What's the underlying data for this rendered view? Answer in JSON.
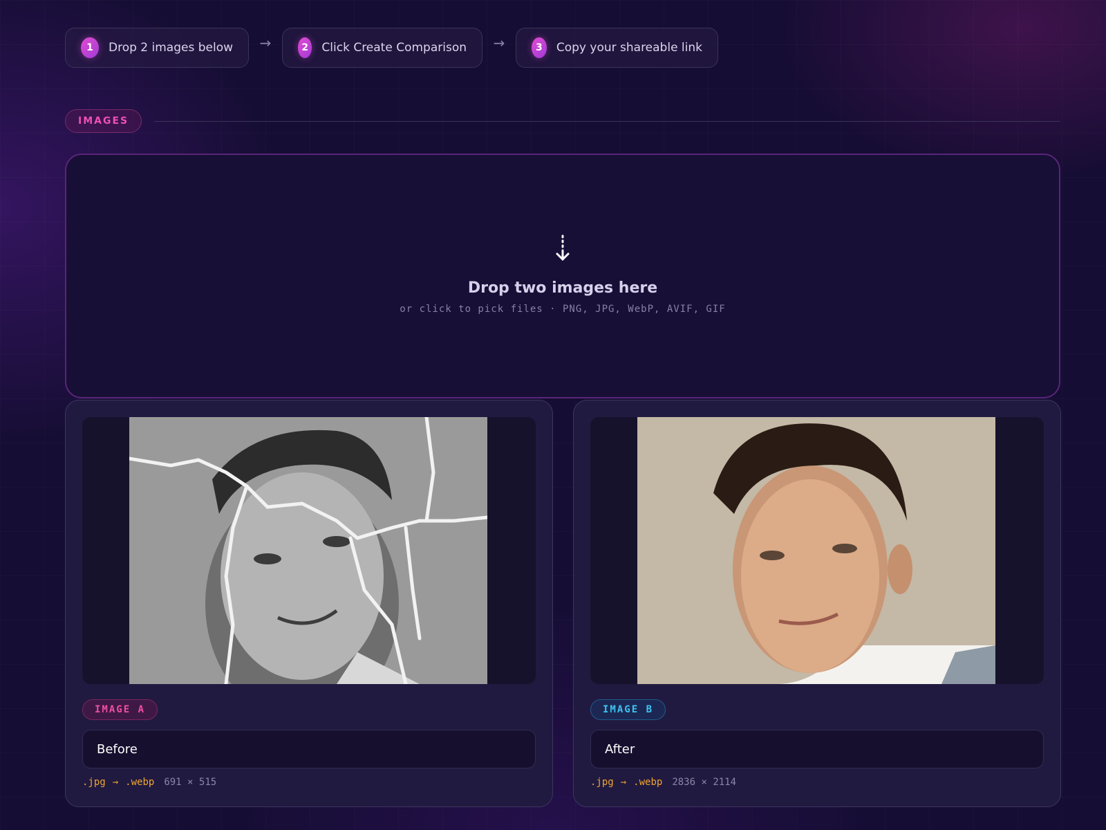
{
  "steps": [
    {
      "number": "1",
      "label": "Drop 2 images below"
    },
    {
      "number": "2",
      "label": "Click Create Comparison"
    },
    {
      "number": "3",
      "label": "Copy your shareable link"
    }
  ],
  "step_arrow": "→",
  "section": {
    "label": "IMAGES"
  },
  "dropzone": {
    "icon": "dashed-down-arrow-icon",
    "title": "Drop two images here",
    "subtitle": "or click to pick files · PNG, JPG, WebP, AVIF, GIF"
  },
  "images": [
    {
      "tag": "IMAGE A",
      "name": "Before",
      "from_format": ".jpg",
      "arrow": "→",
      "to_format": ".webp",
      "dimensions": "691 × 515",
      "preview": "black-and-white damaged portrait photo"
    },
    {
      "tag": "IMAGE B",
      "name": "After",
      "from_format": ".jpg",
      "arrow": "→",
      "to_format": ".webp",
      "dimensions": "2836 × 2114",
      "preview": "restored color portrait photo"
    }
  ],
  "colors": {
    "background": "#150d33",
    "accent_pink": "#ee4fb6",
    "accent_blue": "#3fc2f0",
    "format_orange": "#f0a630"
  }
}
